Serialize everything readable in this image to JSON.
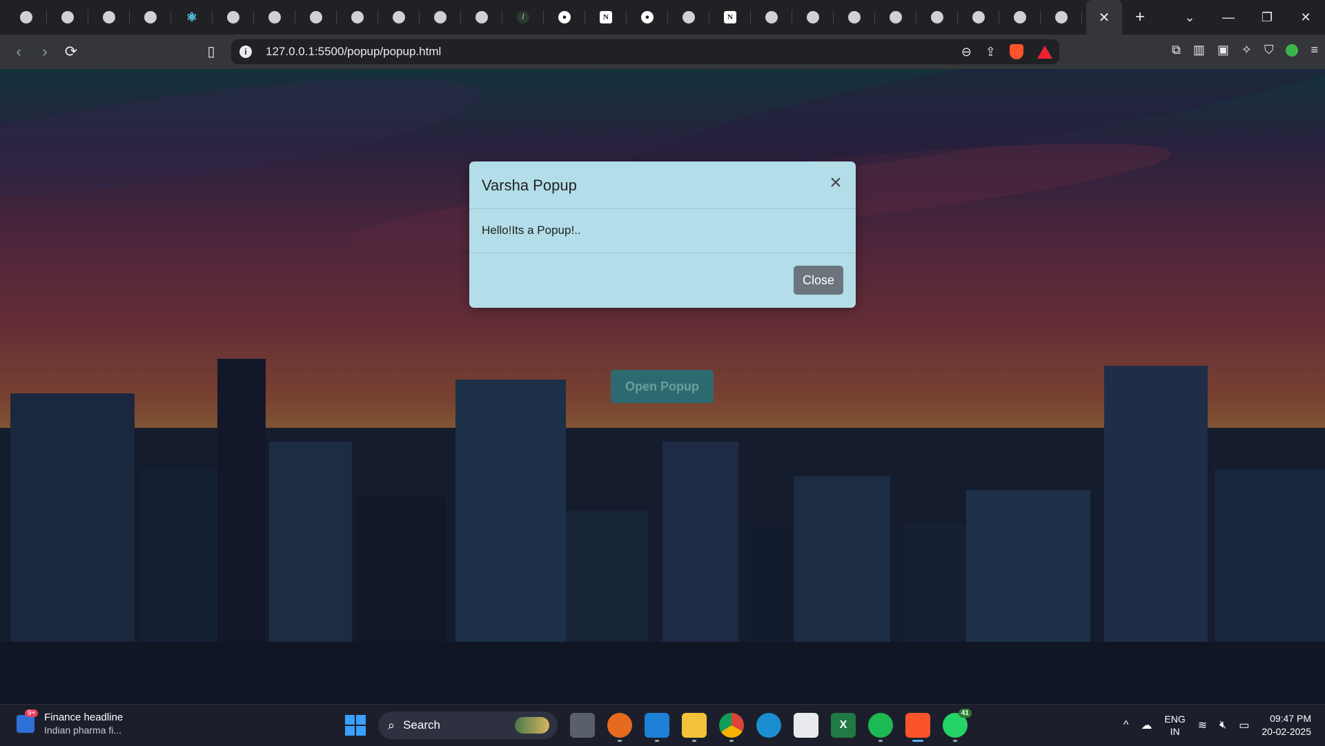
{
  "browser": {
    "tab_count_visible": 26,
    "tabs": [
      {
        "icon": "globe-icon"
      },
      {
        "icon": "globe-icon"
      },
      {
        "icon": "globe-icon"
      },
      {
        "icon": "globe-icon"
      },
      {
        "icon": "react-icon"
      },
      {
        "icon": "globe-icon"
      },
      {
        "icon": "globe-icon"
      },
      {
        "icon": "globe-icon"
      },
      {
        "icon": "globe-icon"
      },
      {
        "icon": "globe-icon"
      },
      {
        "icon": "globe-icon"
      },
      {
        "icon": "globe-icon"
      },
      {
        "icon": "dark-app-icon"
      },
      {
        "icon": "github-icon"
      },
      {
        "icon": "notion-icon"
      },
      {
        "icon": "github-icon"
      },
      {
        "icon": "globe-icon"
      },
      {
        "icon": "notion-icon"
      },
      {
        "icon": "globe-icon"
      },
      {
        "icon": "globe-icon"
      },
      {
        "icon": "globe-icon"
      },
      {
        "icon": "globe-icon"
      },
      {
        "icon": "globe-icon"
      },
      {
        "icon": "globe-icon"
      },
      {
        "icon": "globe-icon"
      },
      {
        "icon": "globe-icon"
      }
    ],
    "active_tab_close": "✕",
    "new_tab": "+",
    "window_controls": {
      "dropdown": "⌄",
      "minimize": "—",
      "restore": "❐",
      "close": "✕"
    },
    "url": "127.0.0.1:5500/popup/popup.html"
  },
  "page": {
    "open_button_label": "Open Popup",
    "modal": {
      "title": "Varsha Popup",
      "body": "Hello!Its a Popup!..",
      "close_label": "Close",
      "close_icon": "×"
    }
  },
  "taskbar": {
    "widget": {
      "title": "Finance headline",
      "subtitle": "Indian pharma fi...",
      "badge": "9+"
    },
    "search_label": "Search",
    "apps": [
      {
        "name": "task-view",
        "glyph": ""
      },
      {
        "name": "firefox",
        "glyph": ""
      },
      {
        "name": "vscode",
        "glyph": ""
      },
      {
        "name": "file-explorer",
        "glyph": ""
      },
      {
        "name": "chrome",
        "glyph": ""
      },
      {
        "name": "edge",
        "glyph": ""
      },
      {
        "name": "microsoft-store",
        "glyph": ""
      },
      {
        "name": "excel",
        "glyph": "X"
      },
      {
        "name": "spotify",
        "glyph": ""
      },
      {
        "name": "brave",
        "glyph": ""
      },
      {
        "name": "whatsapp",
        "glyph": "",
        "badge": "41"
      }
    ],
    "tray": {
      "language_top": "ENG",
      "language_bottom": "IN",
      "time": "09:47 PM",
      "date": "20-02-2025"
    }
  },
  "colors": {
    "modal_bg": "#b3dde8",
    "close_button_bg": "#6c757d",
    "open_button_bg": "#2d6a70"
  }
}
